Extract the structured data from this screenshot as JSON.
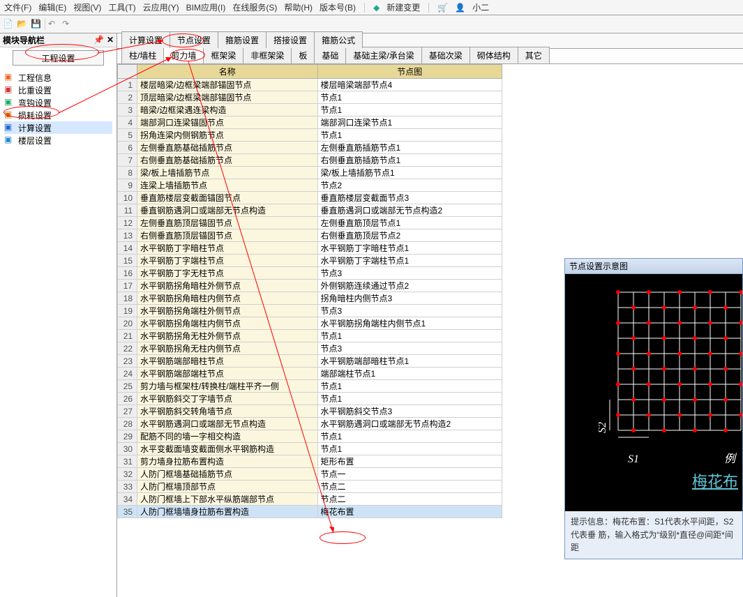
{
  "menu": [
    "文件(F)",
    "编辑(E)",
    "视图(V)",
    "工具(T)",
    "云应用(Y)",
    "BIM应用(I)",
    "在线服务(S)",
    "帮助(H)",
    "版本号(B)"
  ],
  "menu_extra": {
    "new_change": "新建变更",
    "user": "小二"
  },
  "sidebar": {
    "title": "模块导航栏",
    "button": "工程设置",
    "items": [
      {
        "label": "工程信息"
      },
      {
        "label": "比重设置"
      },
      {
        "label": "弯钩设置"
      },
      {
        "label": "损耗设置"
      },
      {
        "label": "计算设置",
        "sel": true
      },
      {
        "label": "楼层设置"
      }
    ]
  },
  "tabs1": [
    "计算设置",
    "节点设置",
    "箍筋设置",
    "搭接设置",
    "箍筋公式"
  ],
  "tabs1_active": 0,
  "tabs2": [
    "柱/墙柱",
    "剪力墙",
    "框架梁",
    "非框架梁",
    "板",
    "基础",
    "基础主梁/承台梁",
    "基础次梁",
    "砌体结构",
    "其它"
  ],
  "tabs2_active": 1,
  "table": {
    "headers": {
      "num": "",
      "name": "名称",
      "node": "节点图"
    },
    "rows": [
      {
        "n": 1,
        "name": "楼层暗梁/边框梁端部锚固节点",
        "node": "楼层暗梁端部节点4"
      },
      {
        "n": 2,
        "name": "顶层暗梁/边框梁端部锚固节点",
        "node": "节点1"
      },
      {
        "n": 3,
        "name": "暗梁/边框梁遇连梁构造",
        "node": "节点1"
      },
      {
        "n": 4,
        "name": "端部洞口连梁锚固节点",
        "node": "端部洞口连梁节点1"
      },
      {
        "n": 5,
        "name": "拐角连梁内侧钢筋节点",
        "node": "节点1"
      },
      {
        "n": 6,
        "name": "左侧垂直筋基础插筋节点",
        "node": "左侧垂直筋插筋节点1"
      },
      {
        "n": 7,
        "name": "右侧垂直筋基础插筋节点",
        "node": "右侧垂直筋插筋节点1"
      },
      {
        "n": 8,
        "name": "梁/板上墙插筋节点",
        "node": "梁/板上墙插筋节点1"
      },
      {
        "n": 9,
        "name": "连梁上墙插筋节点",
        "node": "节点2"
      },
      {
        "n": 10,
        "name": "垂直筋楼层变截面锚固节点",
        "node": "垂直筋楼层变截面节点3"
      },
      {
        "n": 11,
        "name": "垂直钢筋遇洞口或端部无节点构造",
        "node": "垂直筋遇洞口或端部无节点构造2"
      },
      {
        "n": 12,
        "name": "左侧垂直筋顶层锚固节点",
        "node": "左侧垂直筋顶层节点1"
      },
      {
        "n": 13,
        "name": "右侧垂直筋顶层锚固节点",
        "node": "右侧垂直筋顶层节点2"
      },
      {
        "n": 14,
        "name": "水平钢筋丁字暗柱节点",
        "node": "水平钢筋丁字暗柱节点1"
      },
      {
        "n": 15,
        "name": "水平钢筋丁字端柱节点",
        "node": "水平钢筋丁字端柱节点1"
      },
      {
        "n": 16,
        "name": "水平钢筋丁字无柱节点",
        "node": "节点3"
      },
      {
        "n": 17,
        "name": "水平钢筋拐角暗柱外侧节点",
        "node": "外侧钢筋连续通过节点2"
      },
      {
        "n": 18,
        "name": "水平钢筋拐角暗柱内侧节点",
        "node": "拐角暗柱内侧节点3"
      },
      {
        "n": 19,
        "name": "水平钢筋拐角端柱外侧节点",
        "node": "节点3"
      },
      {
        "n": 20,
        "name": "水平钢筋拐角端柱内侧节点",
        "node": "水平钢筋拐角端柱内侧节点1"
      },
      {
        "n": 21,
        "name": "水平钢筋拐角无柱外侧节点",
        "node": "节点1"
      },
      {
        "n": 22,
        "name": "水平钢筋拐角无柱内侧节点",
        "node": "节点3"
      },
      {
        "n": 23,
        "name": "水平钢筋端部暗柱节点",
        "node": "水平钢筋端部暗柱节点1"
      },
      {
        "n": 24,
        "name": "水平钢筋端部端柱节点",
        "node": "端部端柱节点1"
      },
      {
        "n": 25,
        "name": "剪力墙与框架柱/转换柱/端柱平齐一侧",
        "node": "节点1"
      },
      {
        "n": 26,
        "name": "水平钢筋斜交丁字墙节点",
        "node": "节点1"
      },
      {
        "n": 27,
        "name": "水平钢筋斜交转角墙节点",
        "node": "水平钢筋斜交节点3"
      },
      {
        "n": 28,
        "name": "水平钢筋遇洞口或端部无节点构造",
        "node": "水平钢筋遇洞口或端部无节点构造2"
      },
      {
        "n": 29,
        "name": "配筋不同的墙一字相交构造",
        "node": "节点1"
      },
      {
        "n": 30,
        "name": "水平变截面墙变截面侧水平钢筋构造",
        "node": "节点1"
      },
      {
        "n": 31,
        "name": "剪力墙身拉筋布置构造",
        "node": "矩形布置"
      },
      {
        "n": 32,
        "name": "人防门框墙基础插筋节点",
        "node": "节点一"
      },
      {
        "n": 33,
        "name": "人防门框墙顶部节点",
        "node": "节点二"
      },
      {
        "n": 34,
        "name": "人防门框墙上下部水平纵筋端部节点",
        "node": "节点二"
      },
      {
        "n": 35,
        "name": "人防门框墙墙身拉筋布置构造",
        "node": "梅花布置",
        "hl": true
      }
    ]
  },
  "diagram": {
    "title": "节点设置示意图",
    "s1": "S1",
    "s2": "S2",
    "li": "例",
    "link": "梅花布",
    "hint_pre": "提示信息：",
    "hint": "梅花布置：S1代表水平间距，S2代表垂\n筋，输入格式为“级别*直径@间距*间距"
  }
}
